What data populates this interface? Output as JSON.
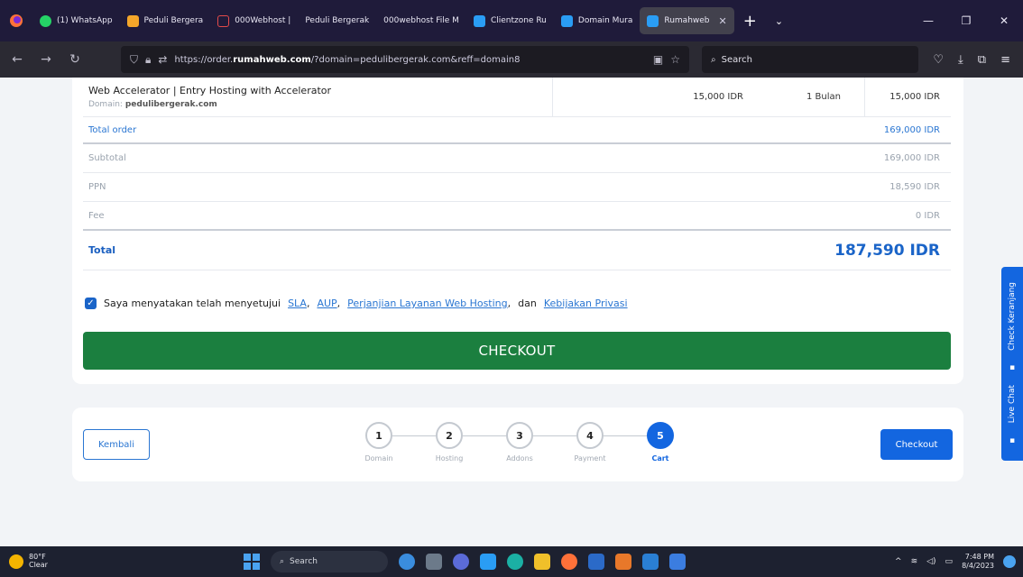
{
  "browser": {
    "tabs": [
      {
        "label": "",
        "color": "#ff7139"
      },
      {
        "label": "(1) WhatsApp",
        "color": "#25d366"
      },
      {
        "label": "Peduli Bergera",
        "color": "#f4a62a"
      },
      {
        "label": "000Webhost |",
        "color": "#e34a4a"
      },
      {
        "label": "Peduli Bergerak",
        "color": "#ffffff"
      },
      {
        "label": "000webhost File M",
        "color": "#e34a4a"
      },
      {
        "label": "Clientzone Ru",
        "color": "#2a9df4"
      },
      {
        "label": "Domain Mura",
        "color": "#2a9df4"
      },
      {
        "label": "Rumahweb",
        "color": "#2a9df4"
      }
    ],
    "url_prefix": "https://order.",
    "url_domain": "rumahweb.com",
    "url_rest": "/?domain=pedulibergerak.com&reff=domain8",
    "search_placeholder": "Search"
  },
  "order": {
    "item": {
      "name": "Web Accelerator | Entry Hosting with Accelerator",
      "domain_label": "Domain:",
      "domain_value": "pedulibergerak.com",
      "price": "15,000 IDR",
      "period": "1 Bulan",
      "total": "15,000 IDR"
    },
    "total_order_label": "Total order",
    "total_order_value": "169,000 IDR",
    "subtotal_label": "Subtotal",
    "subtotal_value": "169,000 IDR",
    "ppn_label": "PPN",
    "ppn_value": "18,590 IDR",
    "fee_label": "Fee",
    "fee_value": "0 IDR",
    "grand_label": "Total",
    "grand_value": "187,590 IDR"
  },
  "agreement": {
    "text_before": "Saya menyatakan telah menyetujui",
    "sla": "SLA",
    "aup": "AUP",
    "perjanjian": "Perjanjian Layanan Web Hosting",
    "dan": "dan",
    "privasi": "Kebijakan Privasi"
  },
  "checkout_big_label": "CHECKOUT",
  "stepper": {
    "back_label": "Kembali",
    "checkout_label": "Checkout",
    "steps": [
      {
        "num": "1",
        "label": "Domain"
      },
      {
        "num": "2",
        "label": "Hosting"
      },
      {
        "num": "3",
        "label": "Addons"
      },
      {
        "num": "4",
        "label": "Payment"
      },
      {
        "num": "5",
        "label": "Cart"
      }
    ]
  },
  "side": {
    "check": "Check Keranjang",
    "chat": "Live Chat"
  },
  "taskbar": {
    "temp": "80°F",
    "condition": "Clear",
    "search": "Search",
    "time": "7:48 PM",
    "date": "8/4/2023"
  }
}
